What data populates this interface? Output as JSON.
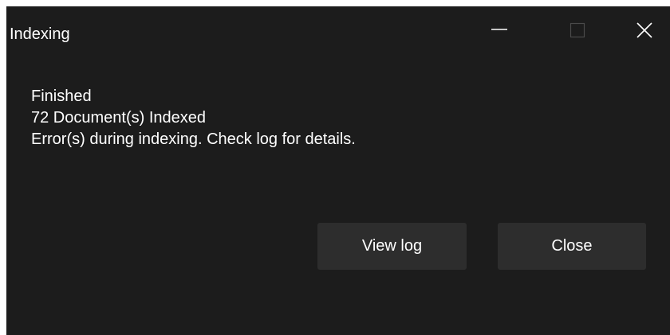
{
  "window": {
    "title": "Indexing"
  },
  "caption_buttons": {
    "minimize_icon": "minimize-icon",
    "maximize_icon": "maximize-icon",
    "close_icon": "close-icon"
  },
  "message": {
    "status": "Finished",
    "count": "72 Document(s) Indexed",
    "error": "Error(s) during indexing. Check log for details."
  },
  "buttons": {
    "view_log": "View log",
    "close": "Close"
  },
  "colors": {
    "background": "#1c1c1c",
    "button_background": "#2d2d2d",
    "text": "#ffffff"
  }
}
